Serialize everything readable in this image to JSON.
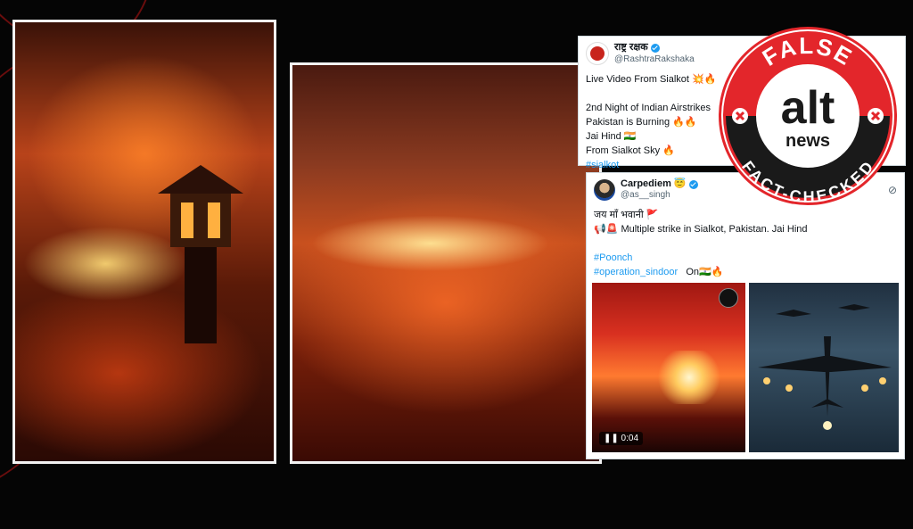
{
  "badge": {
    "top_text": "FALSE",
    "logo_text": "alt",
    "logo_sub": "news",
    "bottom_text": "FACT-CHECKED"
  },
  "tweet1": {
    "name": "राष्ट्र रक्षक",
    "handle": "@RashtraRakshaka",
    "lines": [
      "Live Video From Sialkot 💥🔥",
      "",
      "2nd Night of Indian Airstrikes",
      "Pakistan is Burning 🔥🔥",
      "Jai Hind 🇮🇳",
      "From Sialkot Sky 🔥"
    ],
    "hashtag": "#sialkot"
  },
  "tweet2": {
    "name": "Carpediem 😇",
    "handle": "@as__singh",
    "lines": [
      "जय माँ भवानी 🚩",
      "📢🚨 Multiple strike in Sialkot, Pakistan. Jai Hind"
    ],
    "hashtag1": "#Poonch",
    "hashtag2": "#operation_sindoor",
    "hashtag2_suffix": "On🇮🇳🔥",
    "video_time": "0:04"
  },
  "icons": {
    "grok": "grok-icon",
    "verified": "verified-badge-icon",
    "cross": "cross-icon"
  },
  "colors": {
    "badge_red": "#e3262b",
    "badge_dark": "#1a1a1a",
    "link": "#1d9bf0"
  }
}
